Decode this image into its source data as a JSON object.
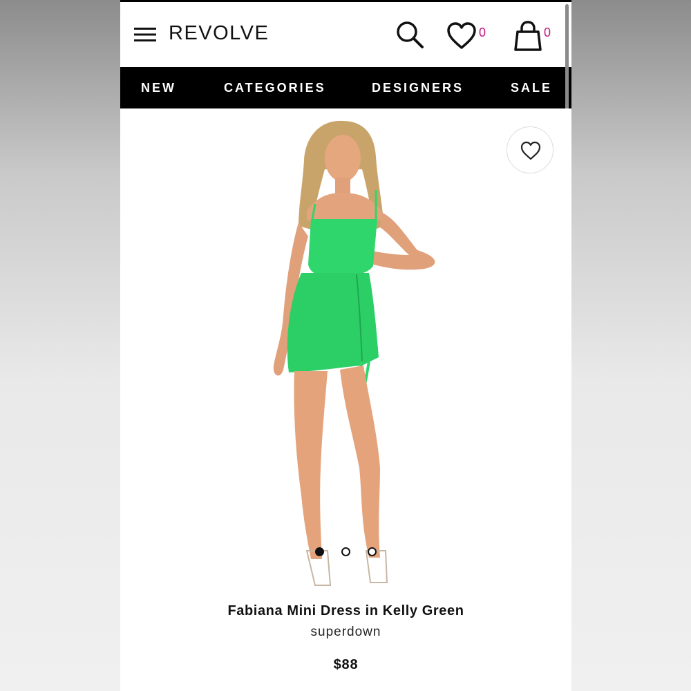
{
  "header": {
    "logo": "REVOLVE",
    "menu_icon": "hamburger-menu-icon",
    "search_icon": "search-icon",
    "wishlist_icon": "heart-icon",
    "wishlist_count": "0",
    "bag_icon": "shopping-bag-icon",
    "bag_count": "0"
  },
  "nav": {
    "items": [
      {
        "label": "NEW"
      },
      {
        "label": "CATEGORIES"
      },
      {
        "label": "DESIGNERS"
      },
      {
        "label": "SALE"
      }
    ]
  },
  "gallery": {
    "favorite_icon": "heart-outline-icon",
    "image_description_icon": "product-photo",
    "slide_count": 3,
    "active_slide": 1
  },
  "product": {
    "name": "Fabiana Mini Dress in Kelly Green",
    "brand": "superdown",
    "price": "$88"
  },
  "colors": {
    "brand_text": "#111111",
    "count_accent": "#c0187f",
    "nav_background": "#000000",
    "dress_green": "#2fd66b"
  }
}
